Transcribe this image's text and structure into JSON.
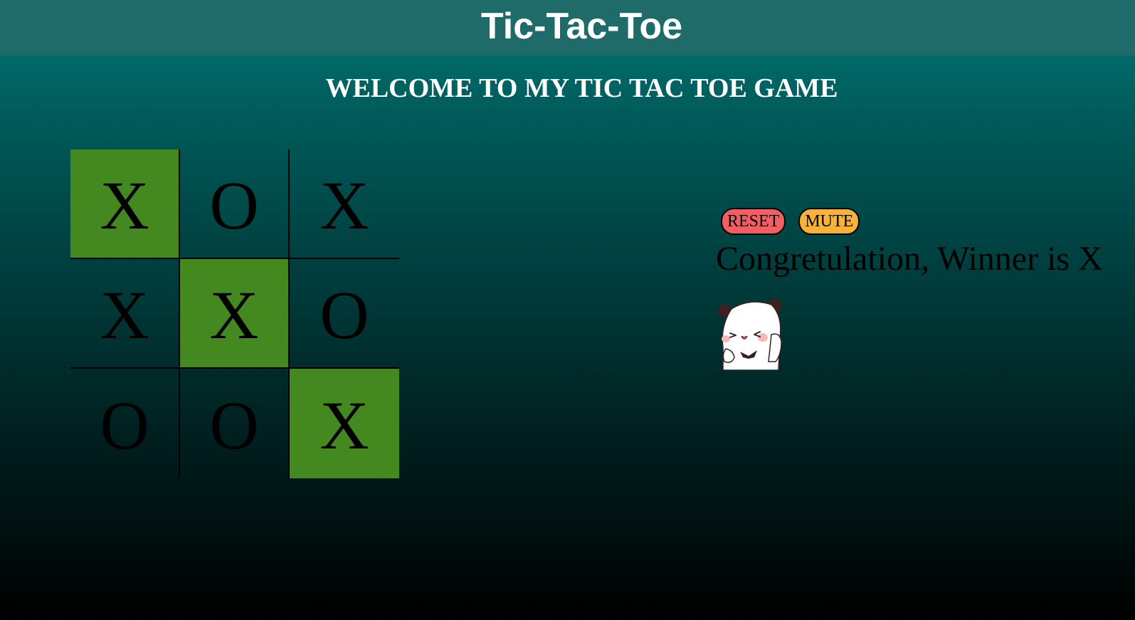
{
  "header": {
    "title": "Tic-Tac-Toe"
  },
  "welcome": "WELCOME TO MY TIC TAC TOE GAME",
  "board": {
    "cells": [
      "X",
      "O",
      "X",
      "X",
      "X",
      "O",
      "O",
      "O",
      "X"
    ],
    "winning_cells": [
      0,
      4,
      8
    ],
    "winning_color": "#448820"
  },
  "controls": {
    "reset_label": "RESET",
    "mute_label": "MUTE"
  },
  "status": {
    "message": "Congretulation, Winner is X"
  },
  "sticker": {
    "icon": "panda-celebrate-icon"
  },
  "colors": {
    "header_bg": "#1f6b6a",
    "reset_bg": "#f25f63",
    "mute_bg": "#f7b23b"
  }
}
